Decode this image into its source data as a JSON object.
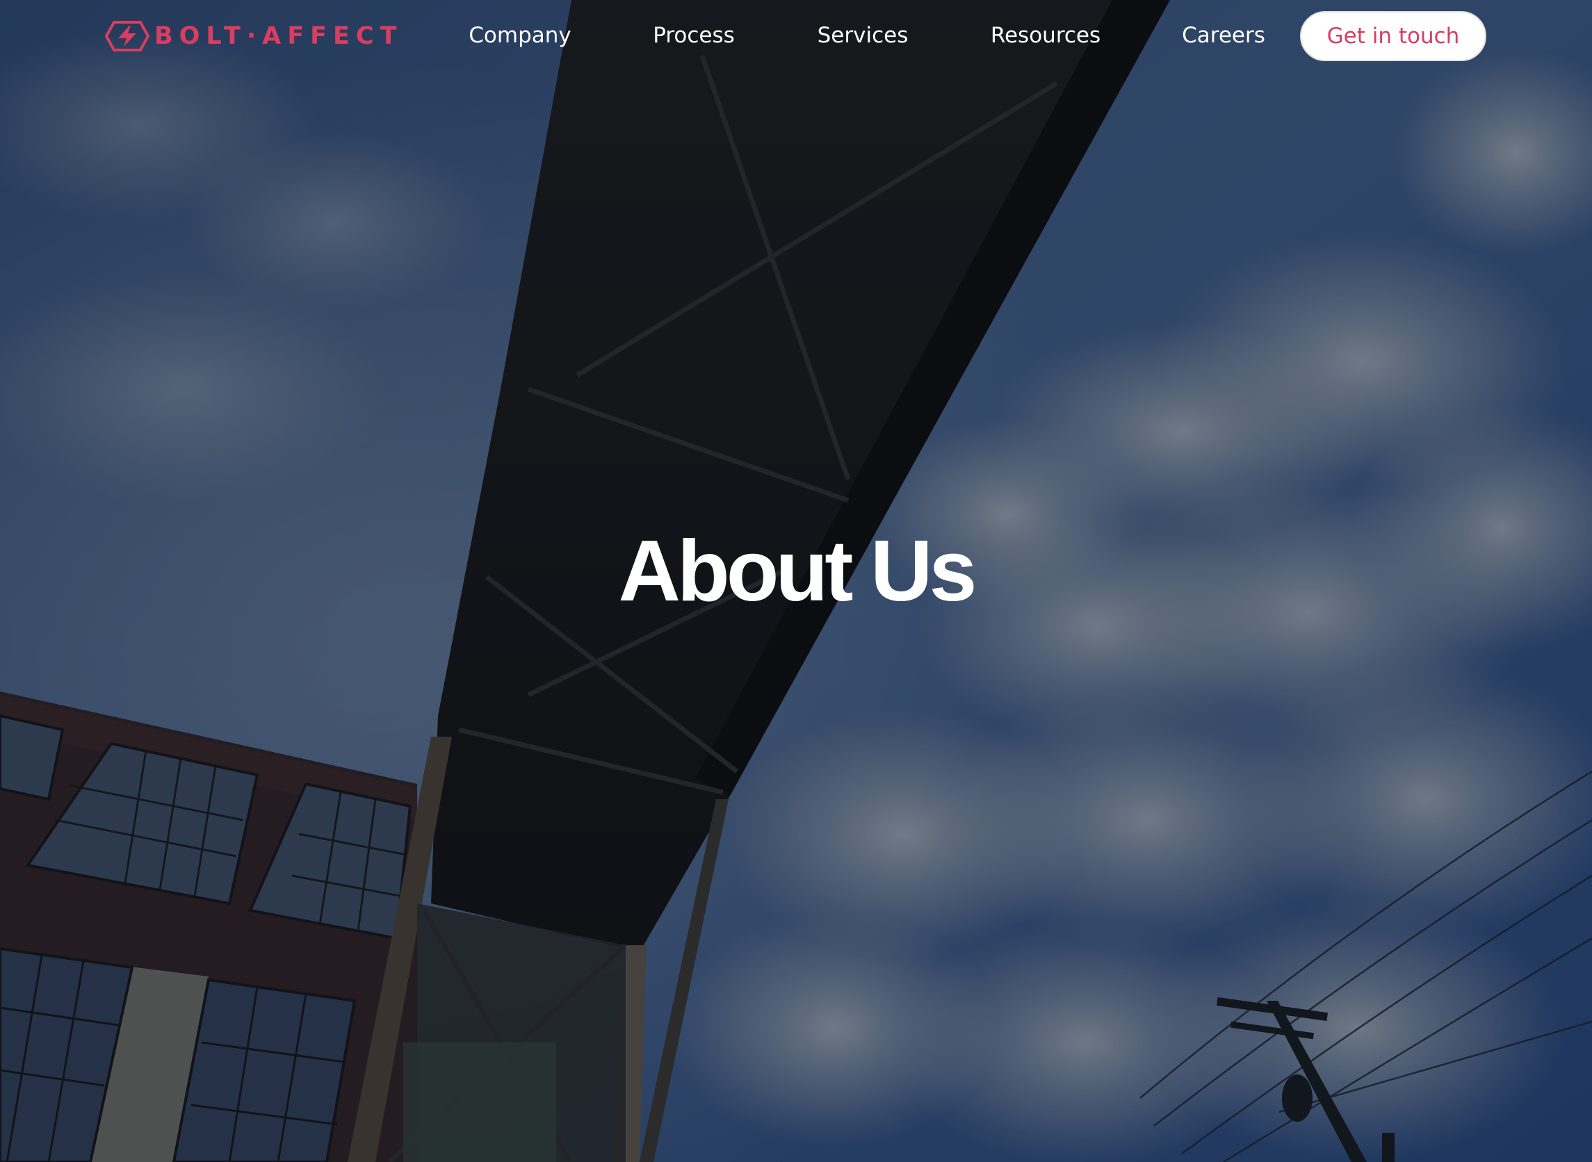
{
  "brand": {
    "logo_text": "BOLT·AFFECT",
    "logo_icon": "bolt-hexagon-icon",
    "accent_color": "#d83d62"
  },
  "nav": {
    "items": [
      {
        "label": "Company"
      },
      {
        "label": "Process"
      },
      {
        "label": "Services"
      },
      {
        "label": "Resources"
      },
      {
        "label": "Careers"
      }
    ],
    "cta_label": "Get in touch"
  },
  "hero": {
    "title": "About Us",
    "background_image": "industrial-building-skybridge-sky-photo"
  }
}
